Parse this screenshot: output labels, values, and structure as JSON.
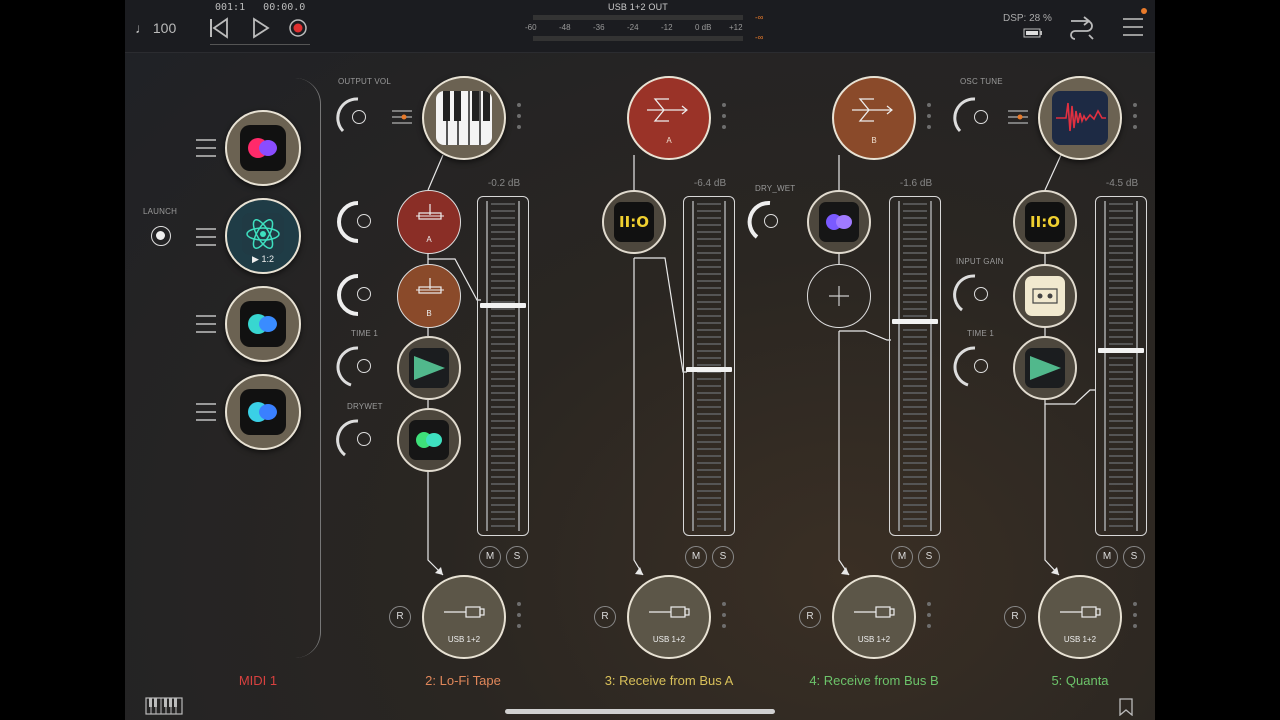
{
  "topbar": {
    "tempo": "100",
    "position": "001:1",
    "time": "00:00.0",
    "output_label": "USB 1+2 OUT",
    "meter_scale": [
      "-60",
      "-48",
      "-36",
      "-24",
      "-12",
      "0 dB",
      "+12"
    ],
    "meter_clip": "-∞",
    "dsp": "DSP: 28 %"
  },
  "launch": {
    "label": "LAUNCH",
    "badge": "1:2"
  },
  "channels": [
    {
      "name": "MIDI 1",
      "color": "#d8413f"
    },
    {
      "name": "2: Lo-Fi Tape",
      "color": "#e0875a",
      "db": "-0.2 dB",
      "fader_level": 0.31,
      "knobs": [
        "OUTPUT VOL",
        "TIME 1",
        "DRYWET"
      ],
      "send_a": "A",
      "send_b": "B",
      "output": "USB 1+2"
    },
    {
      "name": "3: Receive from Bus A",
      "color": "#d8c05a",
      "db": "-6.4 dB",
      "fader_level": 0.51,
      "bus": "A",
      "knobs": [
        "DRY_WET"
      ],
      "output": "USB 1+2"
    },
    {
      "name": "4: Receive from Bus B",
      "color": "#6cc36a",
      "db": "-1.6 dB",
      "fader_level": 0.36,
      "bus": "B",
      "output": "USB 1+2"
    },
    {
      "name": "5: Quanta",
      "color": "#6cc36a",
      "db": "-4.5 dB",
      "fader_level": 0.45,
      "knobs": [
        "OSC TUNE",
        "INPUT GAIN",
        "TIME 1"
      ],
      "output": "USB 1+2"
    }
  ],
  "buttons": {
    "mute": "M",
    "solo": "S",
    "record": "R"
  },
  "colors": {
    "bus_red": "#9a3328",
    "bus_brown": "#8a4a2a",
    "background": "#26262a"
  }
}
